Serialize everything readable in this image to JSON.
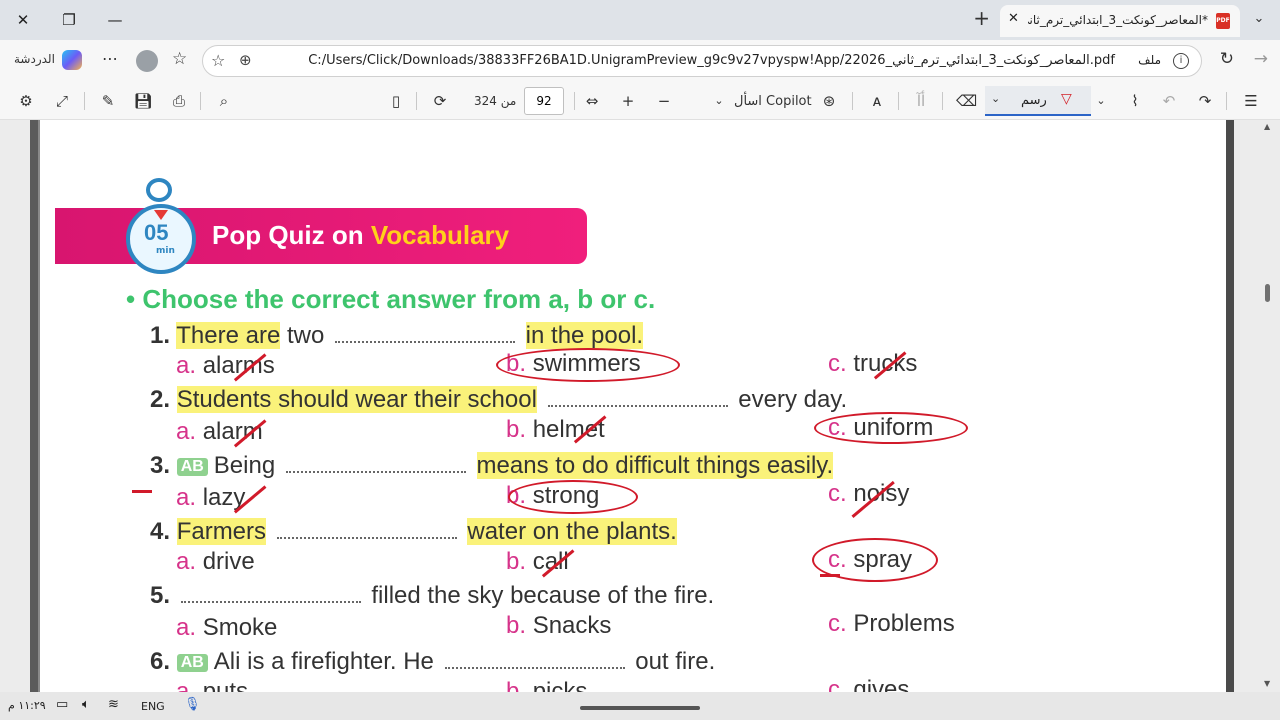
{
  "tab": {
    "title": "*المعاصر_كونكت_3_ابتدائي_ترم_ثاني",
    "pdf_badge": "PDF"
  },
  "address": {
    "chat_label": "الدردشة",
    "url": "C:/Users/Click/Downloads/38833FF26BA1D.UnigramPreview_g9c9v27vpyspw!App/22026_المعاصر_كونكت_3_ابتدائي_ترم_ثاني.pdf",
    "file_label": "ملف"
  },
  "toolbar": {
    "page_current": "92",
    "page_total": "من 324",
    "copilot_ask": "اسأل Copilot",
    "draw_label": "رسم",
    "aa": "ﺃﺁ"
  },
  "doc": {
    "clock_num": "05",
    "clock_min": "min",
    "banner_part1": "Pop Quiz on ",
    "banner_part2": "Vocabulary",
    "instruction": "• Choose the correct answer from a, b or c.",
    "questions": [
      {
        "num": "1.",
        "pre": "There are",
        "pre2": " two",
        "post": "in the pool.",
        "a": "alarms",
        "b": "swimmers",
        "c": "trucks"
      },
      {
        "num": "2.",
        "pre": "Students should wear their school",
        "post": "every day.",
        "a": "alarm",
        "b": "helmet",
        "c": "uniform"
      },
      {
        "num": "3.",
        "badge": "AB",
        "pre": "Being",
        "post": "means to do difficult things easily.",
        "a": "lazy",
        "b": "strong",
        "c": "noisy"
      },
      {
        "num": "4.",
        "pre": "Farmers",
        "post": "water on the plants.",
        "a": "drive",
        "b": "call",
        "c": "spray"
      },
      {
        "num": "5.",
        "pre": "",
        "post": "filled the sky because of the fire.",
        "a": "Smoke",
        "b": "Snacks",
        "c": "Problems"
      },
      {
        "num": "6.",
        "badge": "AB",
        "pre": "Ali is a firefighter. He",
        "post": "out fire.",
        "a": "puts",
        "b": "picks",
        "c": "gives"
      }
    ],
    "opt_letters": {
      "a": "a.",
      "b": "b.",
      "c": "c."
    }
  },
  "taskbar": {
    "time": "١١:٢٩ م",
    "lang": "ENG"
  },
  "colors": {
    "pink": "#d6338a",
    "green": "#3ec46d",
    "highlight": "#faf27a",
    "ink": "#d11a2a"
  }
}
